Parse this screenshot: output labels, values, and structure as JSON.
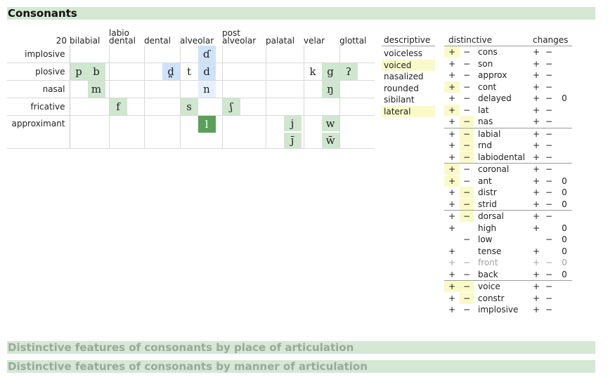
{
  "title": "Consonants",
  "subsections": [
    "Distinctive features of consonants by place of articulation",
    "Distinctive features of consonants by manner of articulation"
  ],
  "grid": {
    "count": "20",
    "columns": [
      {
        "l1": "",
        "l2": "bilabial"
      },
      {
        "l1": "labio",
        "l2": "dental"
      },
      {
        "l1": "",
        "l2": "dental"
      },
      {
        "l1": "",
        "l2": "alveolar"
      },
      {
        "l1": "post",
        "l2": "alveolar"
      },
      {
        "l1": "",
        "l2": "palatal"
      },
      {
        "l1": "",
        "l2": "velar"
      },
      {
        "l1": "",
        "l2": "glottal"
      }
    ],
    "rows": [
      "implosive",
      "plosive",
      "nasal",
      "fricative",
      "approximant"
    ],
    "symbols": {
      "implosive_alveolar_voiced": "ɗ",
      "plosive_bilabial_voiceless": "p",
      "plosive_bilabial_voiced": "b",
      "plosive_dental_voiced": "d̪",
      "plosive_alveolar_voiceless": "t",
      "plosive_alveolar_voiced": "d",
      "plosive_velar_voiceless": "k",
      "plosive_velar_voiced": "g",
      "plosive_glottal": "ʔ",
      "nasal_bilabial": "m",
      "nasal_alveolar": "n",
      "nasal_velar": "ŋ",
      "fricative_labiodental": "f",
      "fricative_alveolar": "s",
      "fricative_postalveolar": "ʃ",
      "approx_alveolar": "l",
      "approx_palatal_1": "j",
      "approx_velar_1": "w",
      "approx_palatal_2": "j̄",
      "approx_velar_2": "w̄"
    }
  },
  "descriptive": {
    "header": "descriptive",
    "items": [
      "voiceless",
      "voiced",
      "nasalized",
      "rounded",
      "sibilant",
      "lateral"
    ],
    "highlighted": [
      "voiced",
      "lateral"
    ]
  },
  "distinctive": {
    "header": "distinctive",
    "changes_header": "changes",
    "features": [
      {
        "plus": "+",
        "minus": "−",
        "name": "cons",
        "cp": "+",
        "cm": "−",
        "cz": ""
      },
      {
        "plus": "+",
        "minus": "−",
        "name": "son",
        "cp": "+",
        "cm": "−",
        "cz": ""
      },
      {
        "plus": "+",
        "minus": "−",
        "name": "approx",
        "cp": "+",
        "cm": "−",
        "cz": ""
      },
      {
        "plus": "+",
        "minus": "−",
        "name": "cont",
        "cp": "+",
        "cm": "−",
        "cz": ""
      },
      {
        "plus": "+",
        "minus": "−",
        "name": "delayed",
        "cp": "+",
        "cm": "−",
        "cz": "0"
      },
      {
        "plus": "+",
        "minus": "−",
        "name": "lat",
        "cp": "+",
        "cm": "−",
        "cz": ""
      },
      {
        "plus": "+",
        "minus": "−",
        "name": "nas",
        "cp": "+",
        "cm": "−",
        "cz": ""
      },
      {
        "plus": "+",
        "minus": "−",
        "name": "labial",
        "cp": "+",
        "cm": "−",
        "cz": ""
      },
      {
        "plus": "+",
        "minus": "−",
        "name": "rnd",
        "cp": "+",
        "cm": "−",
        "cz": ""
      },
      {
        "plus": "+",
        "minus": "−",
        "name": "labiodental",
        "cp": "+",
        "cm": "−",
        "cz": ""
      },
      {
        "plus": "+",
        "minus": "−",
        "name": "coronal",
        "cp": "+",
        "cm": "−",
        "cz": ""
      },
      {
        "plus": "+",
        "minus": "−",
        "name": "ant",
        "cp": "+",
        "cm": "−",
        "cz": "0"
      },
      {
        "plus": "+",
        "minus": "−",
        "name": "distr",
        "cp": "+",
        "cm": "−",
        "cz": "0"
      },
      {
        "plus": "+",
        "minus": "−",
        "name": "strid",
        "cp": "+",
        "cm": "−",
        "cz": "0"
      },
      {
        "plus": "+",
        "minus": "−",
        "name": "dorsal",
        "cp": "+",
        "cm": "−",
        "cz": ""
      },
      {
        "plus": "+",
        "minus": "",
        "name": "high",
        "cp": "+",
        "cm": "",
        "cz": "0"
      },
      {
        "plus": "",
        "minus": "−",
        "name": "low",
        "cp": "",
        "cm": "−",
        "cz": "0"
      },
      {
        "plus": "+",
        "minus": "",
        "name": "tense",
        "cp": "+",
        "cm": "",
        "cz": "0"
      },
      {
        "plus": "+",
        "minus": "−",
        "name": "front",
        "cp": "+",
        "cm": "−",
        "cz": "0"
      },
      {
        "plus": "+",
        "minus": "−",
        "name": "back",
        "cp": "+",
        "cm": "−",
        "cz": "0"
      },
      {
        "plus": "+",
        "minus": "−",
        "name": "voice",
        "cp": "+",
        "cm": "−",
        "cz": ""
      },
      {
        "plus": "+",
        "minus": "−",
        "name": "constr",
        "cp": "+",
        "cm": "−",
        "cz": ""
      },
      {
        "plus": "+",
        "minus": "−",
        "name": "implosive",
        "cp": "+",
        "cm": "−",
        "cz": ""
      }
    ]
  },
  "colors": {
    "section_bar": "#d4e8d4",
    "highlight": "#fafac8",
    "cell_green": "#cfe6cf",
    "cell_blue": "#cfe2fb",
    "cell_selected": "#5a9f5a"
  }
}
